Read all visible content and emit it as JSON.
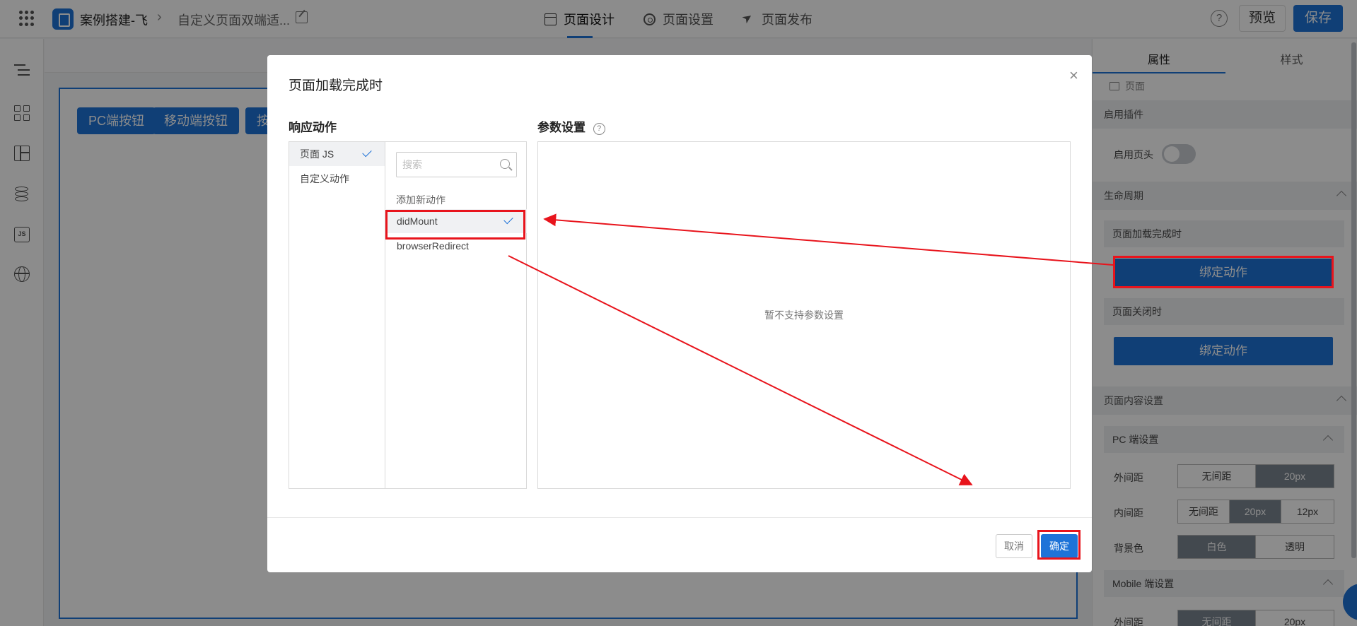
{
  "header": {
    "app_name": "案例搭建-飞",
    "page_name": "自定义页面双端适...",
    "tabs": [
      {
        "label": "页面设计",
        "icon": "layout-icon"
      },
      {
        "label": "页面设置",
        "icon": "gear-icon"
      },
      {
        "label": "页面发布",
        "icon": "send-icon"
      }
    ],
    "help": "?",
    "preview_label": "预览",
    "save_label": "保存"
  },
  "canvas": {
    "buttons": [
      "PC端按钮",
      "移动端按钮",
      "按钮"
    ]
  },
  "panel": {
    "tabs": [
      "属性",
      "样式"
    ],
    "breadcrumb": "页面",
    "plugin_section": "启用插件",
    "header_toggle_label": "启用页头",
    "lifecycle_section": "生命周期",
    "on_load_label": "页面加载完成时",
    "on_load_button": "绑定动作",
    "on_close_label": "页面关闭时",
    "on_close_button": "绑定动作",
    "content_section": "页面内容设置",
    "pc_settings": "PC 端设置",
    "margin_label": "外间距",
    "margin_options": [
      "无间距",
      "20px"
    ],
    "padding_label": "内间距",
    "padding_options": [
      "无间距",
      "20px",
      "12px"
    ],
    "bg_label": "背景色",
    "bg_options": [
      "白色",
      "透明"
    ],
    "mobile_settings": "Mobile 端设置",
    "mobile_margin_label": "外间距",
    "mobile_margin_options": [
      "无间距",
      "20px"
    ]
  },
  "modal": {
    "title": "页面加载完成时",
    "close": "×",
    "response_header": "响应动作",
    "param_header": "参数设置",
    "param_help": "?",
    "categories": [
      "页面 JS",
      "自定义动作"
    ],
    "search_placeholder": "搜索",
    "add_new_label": "添加新动作",
    "actions": [
      "didMount",
      "browserRedirect"
    ],
    "param_empty": "暂不支持参数设置",
    "cancel_label": "取消",
    "ok_label": "确定"
  },
  "colors": {
    "accent": "#1e73d8",
    "annotation": "#e8141c"
  }
}
